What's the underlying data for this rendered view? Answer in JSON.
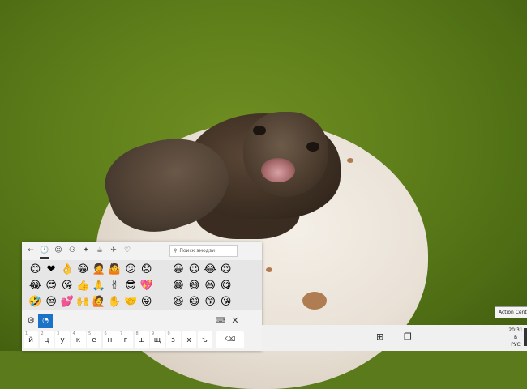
{
  "emoji_panel": {
    "tabs": [
      {
        "icon": "back-arrow-icon",
        "glyph": "←"
      },
      {
        "icon": "recent-clock-icon",
        "glyph": "🕓",
        "active": true
      },
      {
        "icon": "smiley-icon",
        "glyph": "☺"
      },
      {
        "icon": "people-icon",
        "glyph": "⚇"
      },
      {
        "icon": "celebration-icon",
        "glyph": "✦"
      },
      {
        "icon": "food-icon",
        "glyph": "☕"
      },
      {
        "icon": "vehicle-icon",
        "glyph": "✈"
      },
      {
        "icon": "symbols-icon",
        "glyph": "♡"
      }
    ],
    "search_placeholder": "Поиск эмодзи",
    "rows": [
      [
        "😊",
        "❤",
        "👌",
        "😁",
        "🤦",
        "🤷",
        "😕",
        "😟",
        "",
        "😀",
        "😉",
        "😂",
        "😍"
      ],
      [
        "😂",
        "😍",
        "😘",
        "👍",
        "🙏",
        "✌",
        "😎",
        "💖",
        "",
        "😁",
        "😅",
        "😆",
        "😋"
      ],
      [
        "🤣",
        "😒",
        "💕",
        "🙌",
        "🙋",
        "✋",
        "🤝",
        "😜",
        "",
        "😆",
        "😄",
        "😙",
        "😘"
      ]
    ],
    "keys": [
      {
        "n": "1",
        "l": "й"
      },
      {
        "n": "2",
        "l": "ц"
      },
      {
        "n": "3",
        "l": "у"
      },
      {
        "n": "4",
        "l": "к"
      },
      {
        "n": "5",
        "l": "е"
      },
      {
        "n": "6",
        "l": "н"
      },
      {
        "n": "7",
        "l": "г"
      },
      {
        "n": "8",
        "l": "ш"
      },
      {
        "n": "9",
        "l": "щ"
      },
      {
        "n": "0",
        "l": "з"
      },
      {
        "n": "",
        "l": "х"
      },
      {
        "n": "",
        "l": "ъ"
      }
    ]
  },
  "taskbar": {
    "time": "20:31",
    "lang_top": "В",
    "lang": "РУС"
  },
  "tooltip": "Action Center",
  "colors": {
    "accent": "#1a73c7",
    "taskbar": "#f0f0f0"
  }
}
